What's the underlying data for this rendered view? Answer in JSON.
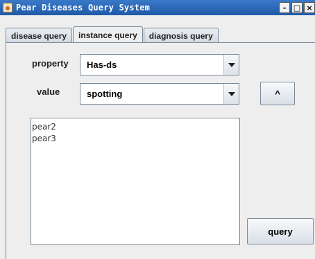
{
  "window": {
    "title": "Pear Diseases Query System"
  },
  "titlebar_controls": {
    "minimize": "-",
    "maximize": "□",
    "close": "×"
  },
  "tabs": [
    {
      "label": "disease query",
      "active": false
    },
    {
      "label": "instance query",
      "active": true
    },
    {
      "label": "diagnosis query",
      "active": false
    }
  ],
  "form": {
    "property_label": "property",
    "property_value": "Has-ds",
    "value_label": "value",
    "value_value": "spotting",
    "caret_button_label": "^"
  },
  "results": [
    "pear2",
    "pear3"
  ],
  "query_button_label": "query",
  "colors": {
    "titlebar": "#2a66b8",
    "panel": "#eeeeee",
    "border": "#7a8a99"
  }
}
